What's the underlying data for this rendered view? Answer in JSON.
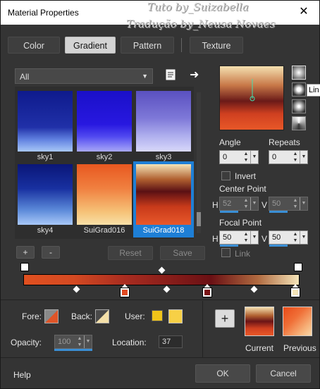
{
  "window": {
    "title": "Material Properties",
    "close": "✕"
  },
  "watermark": {
    "line1": "Tuto by_Suizabella",
    "line2": "Tradução by_Neusa Novaes"
  },
  "tabs": [
    {
      "label": "Color"
    },
    {
      "label": "Gradient"
    },
    {
      "label": "Pattern"
    },
    {
      "label": "Texture"
    }
  ],
  "category": {
    "value": "All"
  },
  "swatches": [
    {
      "name": "sky1"
    },
    {
      "name": "sky2"
    },
    {
      "name": "sky3"
    },
    {
      "name": "sky4"
    },
    {
      "name": "SuiGrad016"
    },
    {
      "name": "SuiGrad018"
    }
  ],
  "list_buttons": {
    "add": "+",
    "remove": "-",
    "reset": "Reset",
    "save": "Save"
  },
  "preview_side_tooltip": "Lin",
  "angle": {
    "label": "Angle",
    "value": "0"
  },
  "repeats": {
    "label": "Repeats",
    "value": "0"
  },
  "invert": {
    "label": "Invert"
  },
  "center_point": {
    "label": "Center Point",
    "h_label": "H",
    "h": "52",
    "v_label": "V",
    "v": "50"
  },
  "focal_point": {
    "label": "Focal Point",
    "h_label": "H",
    "h": "50",
    "v_label": "V",
    "v": "50"
  },
  "link": {
    "label": "Link"
  },
  "bottom": {
    "fore_label": "Fore:",
    "back_label": "Back:",
    "user_label": "User:",
    "opacity_label": "Opacity:",
    "opacity": "100",
    "location_label": "Location:",
    "location": "37",
    "plus": "+",
    "current_label": "Current",
    "previous_label": "Previous"
  },
  "footer": {
    "help": "Help",
    "ok": "OK",
    "cancel": "Cancel"
  },
  "colors": {
    "accent": "#1e7fd6",
    "user1": "#f0c419",
    "user2": "#f7d046"
  }
}
